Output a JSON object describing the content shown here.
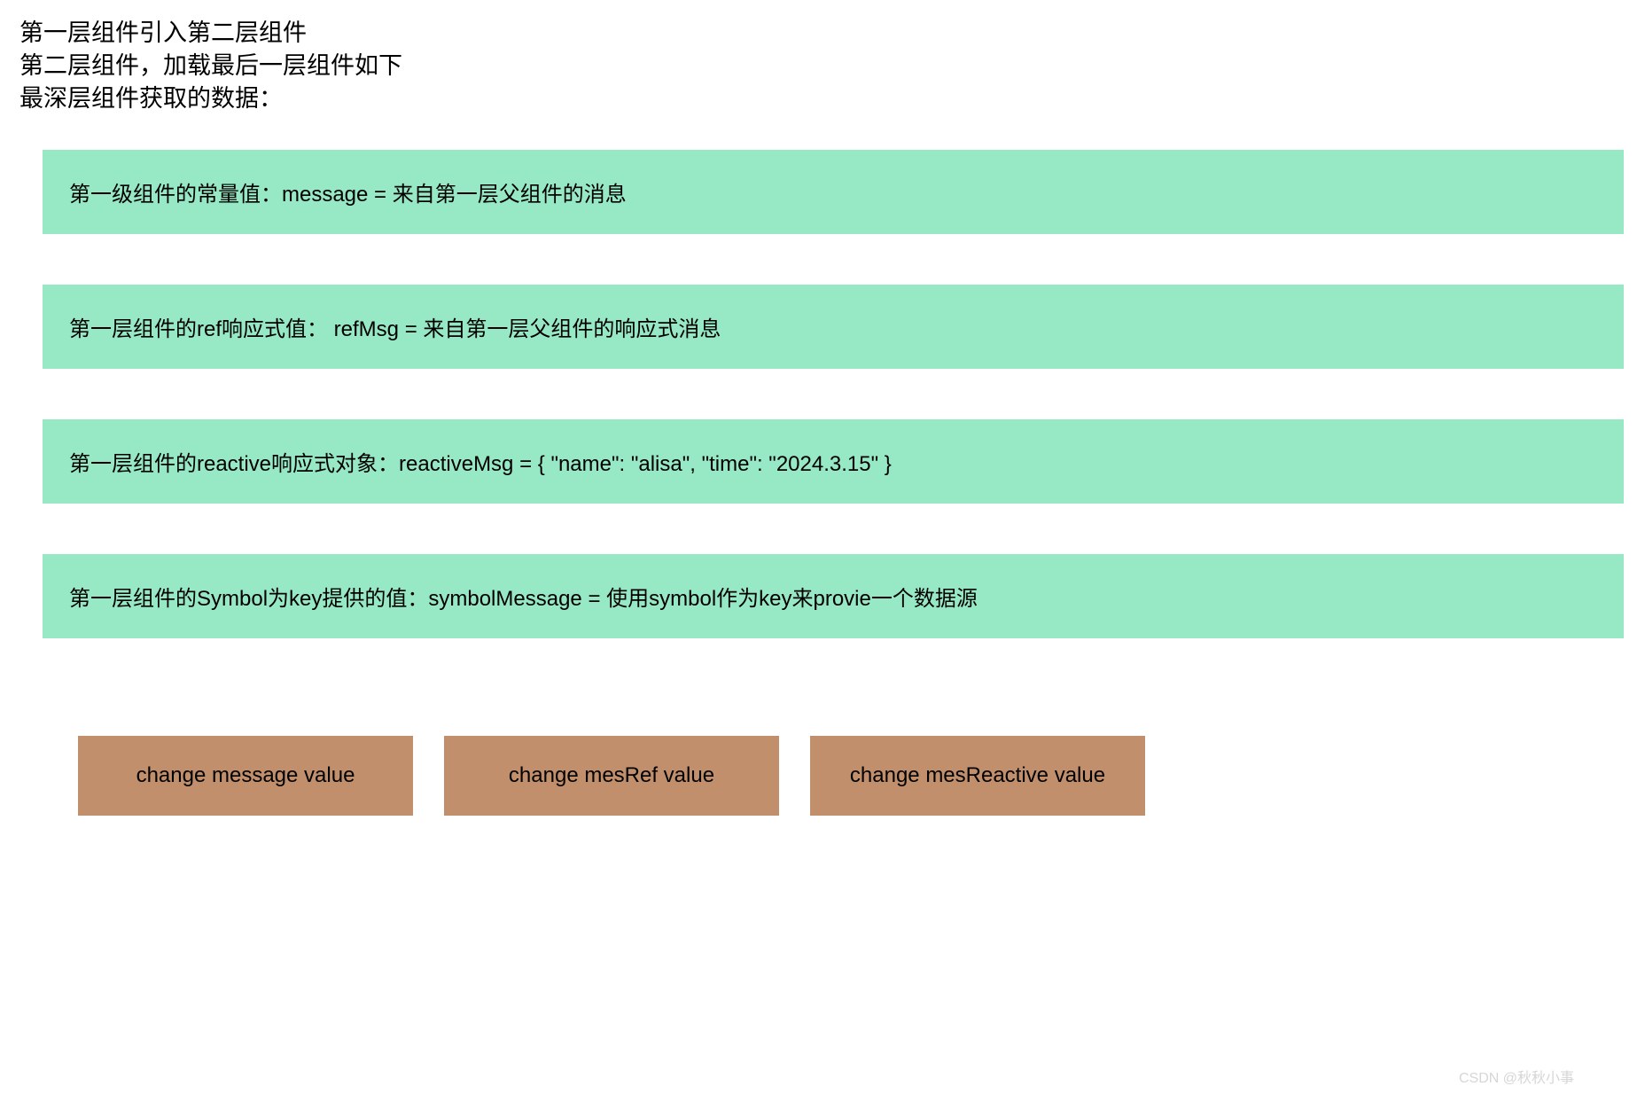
{
  "header": {
    "line1": "第一层组件引入第二层组件",
    "line2": "第二层组件，加载最后一层组件如下",
    "line3": "最深层组件获取的数据："
  },
  "boxes": {
    "box1": "第一级组件的常量值：message = 来自第一层父组件的消息",
    "box2": "第一层组件的ref响应式值：  refMsg = 来自第一层父组件的响应式消息",
    "box3": "第一层组件的reactive响应式对象：reactiveMsg = { \"name\": \"alisa\", \"time\": \"2024.3.15\" }",
    "box4": "第一层组件的Symbol为key提供的值：symbolMessage = 使用symbol作为key来provie一个数据源"
  },
  "buttons": {
    "btn1": "change message value",
    "btn2": "change mesRef value",
    "btn3": "change mesReactive value"
  },
  "watermark": "CSDN @秋秋小事"
}
